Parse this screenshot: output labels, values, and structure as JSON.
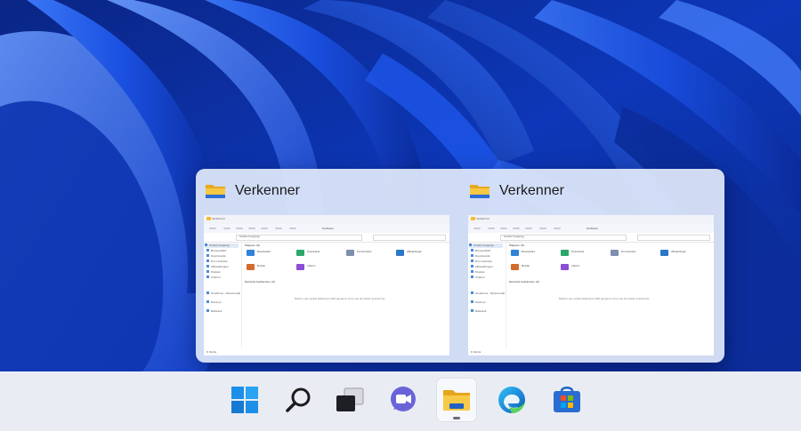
{
  "desktop": {
    "wallpaper": "windows-11-bloom",
    "colors": {
      "deep": "#0a2a8f",
      "mid": "#1d55e6",
      "light": "#5b8cf7",
      "flyout_bg": "#e0e8fa",
      "taskbar_bg": "#e9ecf3"
    }
  },
  "task_preview": {
    "windows": [
      {
        "title": "Verkenner",
        "icon": "file-explorer-folder-icon",
        "mini": {
          "tab": "Verkenner",
          "sort": "Sorteren",
          "path": "Snelle toegang",
          "search": "Zoeken in Snelle toegang",
          "sidebar": [
            "Snelle toegang",
            "Bureaublad",
            "Downloads",
            "Documenten",
            "Afbeeldingen",
            "Muziek",
            "Video's",
            "OneDrive - Persoonlijk",
            "Deze pc",
            "Netwerk"
          ],
          "section_folders": "Mappen (6)",
          "section_recent": "Recente bestanden (0)",
          "folders": [
            "Bureaublad",
            "Downloads",
            "Documenten",
            "Afbeeldingen",
            "Muziek",
            "Video's"
          ],
          "empty": "Nadat u een aantal bestanden hebt geopend, tonen we de meest recente hier.",
          "status": "6 items"
        }
      },
      {
        "title": "Verkenner",
        "icon": "file-explorer-folder-icon",
        "mini": {
          "tab": "Verkenner",
          "sort": "Sorteren",
          "path": "Snelle toegang",
          "search": "Zoeken in Snelle toegang",
          "sidebar": [
            "Snelle toegang",
            "Bureaublad",
            "Downloads",
            "Documenten",
            "Afbeeldingen",
            "Muziek",
            "Video's",
            "OneDrive - Persoonlijk",
            "Deze pc",
            "Netwerk"
          ],
          "section_folders": "Mappen (6)",
          "section_recent": "Recente bestanden (0)",
          "folders": [
            "Bureaublad",
            "Downloads",
            "Documenten",
            "Afbeeldingen",
            "Muziek",
            "Video's"
          ],
          "empty": "Nadat u een aantal bestanden hebt geopend, tonen we de meest recente hier.",
          "status": "6 items"
        }
      }
    ]
  },
  "taskbar": {
    "items": [
      {
        "id": "start",
        "icon": "windows-start-icon",
        "active": false
      },
      {
        "id": "search",
        "icon": "search-icon",
        "active": false
      },
      {
        "id": "task-view",
        "icon": "task-view-icon",
        "active": false
      },
      {
        "id": "teams-chat",
        "icon": "teams-chat-icon",
        "active": false
      },
      {
        "id": "file-explorer",
        "icon": "file-explorer-icon",
        "active": true
      },
      {
        "id": "edge",
        "icon": "edge-browser-icon",
        "active": false
      },
      {
        "id": "store",
        "icon": "microsoft-store-icon",
        "active": false
      }
    ]
  }
}
